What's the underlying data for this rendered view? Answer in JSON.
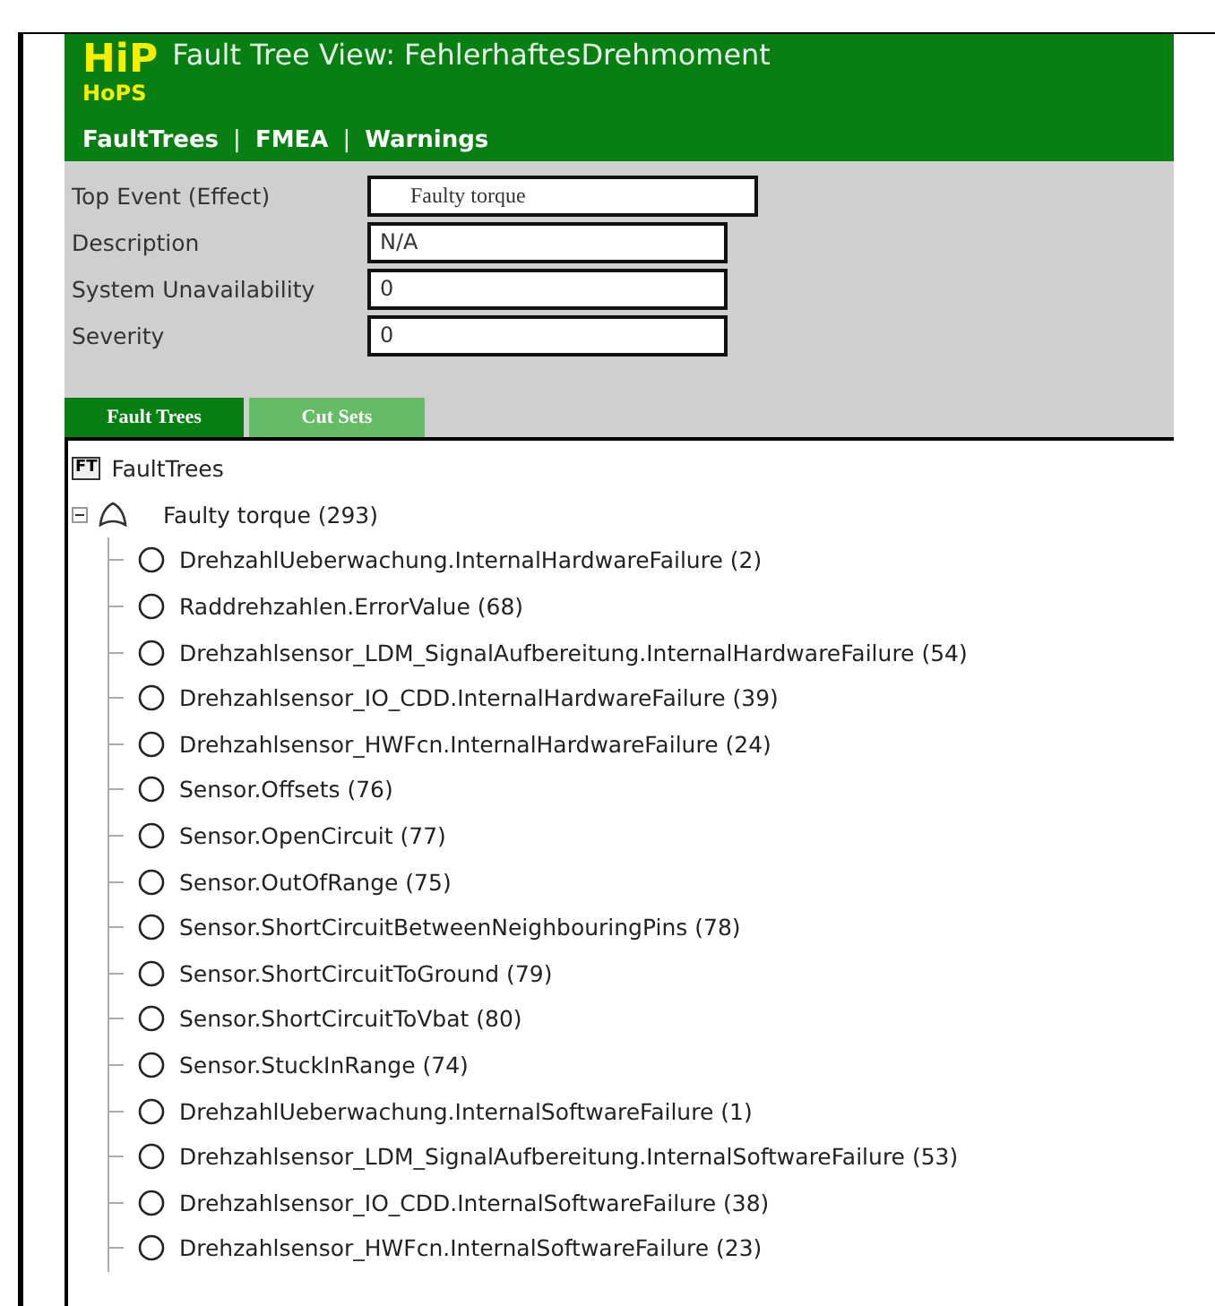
{
  "header": {
    "logo": [
      "HiP",
      "HoPS"
    ],
    "title": "Fault Tree View: FehlerhaftesDrehmoment",
    "nav": [
      {
        "label": "FaultTrees"
      },
      {
        "label": "FMEA"
      },
      {
        "label": "Warnings"
      }
    ],
    "separator": "|"
  },
  "form": [
    {
      "label": "Top Event (Effect)",
      "value": "Faulty torque",
      "kind": "serif"
    },
    {
      "label": "Description",
      "value": "N/A",
      "kind": "sans"
    },
    {
      "label": "System Unavailability",
      "value": "0",
      "kind": "sans"
    },
    {
      "label": "Severity",
      "value": "0",
      "kind": "sans"
    }
  ],
  "tabs": [
    {
      "label": "Fault Trees",
      "selected": true
    },
    {
      "label": "Cut Sets",
      "selected": false
    }
  ],
  "tree": {
    "root": {
      "label": "FaultTrees",
      "badge": "FT"
    },
    "top": {
      "label": "Faulty torque (293)",
      "expanded": true,
      "children": [
        {
          "label": "DrehzahlUeberwachung.InternalHardwareFailure (2)"
        },
        {
          "label": "Raddrehzahlen.ErrorValue (68)"
        },
        {
          "label": "Drehzahlsensor_LDM_SignalAufbereitung.InternalHardwareFailure (54)"
        },
        {
          "label": "Drehzahlsensor_IO_CDD.InternalHardwareFailure (39)"
        },
        {
          "label": "Drehzahlsensor_HWFcn.InternalHardwareFailure (24)"
        },
        {
          "label": "Sensor.Offsets (76)"
        },
        {
          "label": "Sensor.OpenCircuit (77)"
        },
        {
          "label": "Sensor.OutOfRange (75)"
        },
        {
          "label": "Sensor.ShortCircuitBetweenNeighbouringPins (78)"
        },
        {
          "label": "Sensor.ShortCircuitToGround (79)"
        },
        {
          "label": "Sensor.ShortCircuitToVbat (80)"
        },
        {
          "label": "Sensor.StuckInRange (74)"
        },
        {
          "label": "DrehzahlUeberwachung.InternalSoftwareFailure (1)"
        },
        {
          "label": "Drehzahlsensor_LDM_SignalAufbereitung.InternalSoftwareFailure (53)"
        },
        {
          "label": "Drehzahlsensor_IO_CDD.InternalSoftwareFailure (38)"
        },
        {
          "label": "Drehzahlsensor_HWFcn.InternalSoftwareFailure (23)"
        }
      ]
    }
  }
}
